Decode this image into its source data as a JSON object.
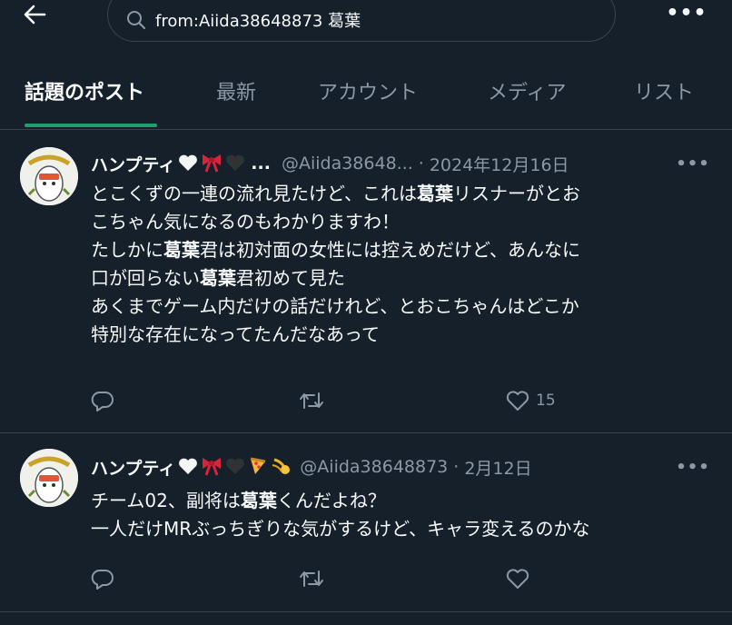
{
  "header": {
    "search_query": "from:Aiida38648873 葛葉"
  },
  "tabs": [
    {
      "label": "話題のポスト",
      "active": true
    },
    {
      "label": "最新",
      "active": false
    },
    {
      "label": "アカウント",
      "active": false
    },
    {
      "label": "メディア",
      "active": false
    },
    {
      "label": "リスト",
      "active": false
    }
  ],
  "posts": [
    {
      "display_name": "ハンプティ",
      "name_truncation": "...",
      "handle": "@Aiida38648...",
      "separator": "·",
      "date": "2024年12月16日",
      "lines": [
        [
          "とこくずの一連の流れ見たけど、これは",
          "葛葉",
          "リスナーがとお"
        ],
        [
          "こちゃん気になるのもわかりますわ！",
          "",
          ""
        ],
        [
          "たしかに",
          "葛葉",
          "君は初対面の女性には控えめだけど、あんなに"
        ],
        [
          "口が回らない",
          "葛葉",
          "君初めて見た"
        ],
        [
          "あくまでゲーム内だけの話だけれど、とおこちゃんはどこか",
          "",
          ""
        ],
        [
          "特別な存在になってたんだなあって",
          "",
          ""
        ]
      ],
      "like_count": "15"
    },
    {
      "display_name": "ハンプティ",
      "handle": "@Aiida38648873",
      "separator": "·",
      "date": "2月12日",
      "lines": [
        [
          "チーム02、副将は",
          "葛葉",
          "くんだよね？"
        ],
        [
          "一人だけMRぶっちぎりな気がするけど、キャラ変えるのかな",
          "",
          ""
        ]
      ],
      "like_count": ""
    }
  ],
  "colors": {
    "background": "#15202b",
    "text": "#f7f9f9",
    "muted": "#8b98a5",
    "border": "#38444d",
    "tab_indicator": "#1d9e6e"
  },
  "icons": [
    "back-arrow-icon",
    "search-icon",
    "more-icon",
    "reply-icon",
    "repost-icon",
    "like-icon",
    "white-heart-emoji",
    "ribbon-emoji",
    "black-heart-emoji",
    "pizza-emoji",
    "comet-emoji"
  ]
}
